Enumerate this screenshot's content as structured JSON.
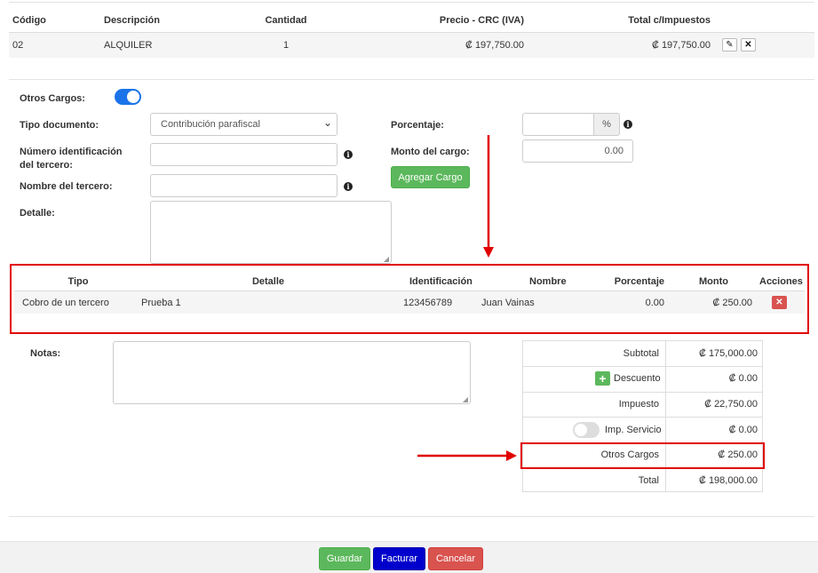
{
  "items_table": {
    "headers": {
      "codigo": "Código",
      "descripcion": "Descripción",
      "cantidad": "Cantidad",
      "precio": "Precio - CRC (IVA)",
      "total": "Total c/Impuestos"
    },
    "rows": [
      {
        "codigo": "02",
        "descripcion": "ALQUILER",
        "cantidad": "1",
        "precio": "₡ 197,750.00",
        "total": "₡ 197,750.00"
      }
    ]
  },
  "otros_cargos": {
    "toggle_label": "Otros Cargos:",
    "toggle_on": true,
    "tipo_documento_label": "Tipo documento:",
    "tipo_documento_value": "Contribución parafiscal",
    "numero_id_label_1": "Número identificación",
    "numero_id_label_2": "del tercero:",
    "nombre_label": "Nombre del tercero:",
    "detalle_label": "Detalle:",
    "porcentaje_label": "Porcentaje:",
    "porcentaje_addon": "%",
    "monto_label": "Monto del cargo:",
    "monto_value": "0.00",
    "agregar_button": "Agregar Cargo"
  },
  "cargos_table": {
    "headers": {
      "tipo": "Tipo",
      "detalle": "Detalle",
      "identificacion": "Identificación",
      "nombre": "Nombre",
      "porcentaje": "Porcentaje",
      "monto": "Monto",
      "acciones": "Acciones"
    },
    "rows": [
      {
        "tipo": "Cobro de un tercero",
        "detalle": "Prueba 1",
        "identificacion": "123456789",
        "nombre": "Juan Vainas",
        "porcentaje": "0.00",
        "monto": "₡ 250.00"
      }
    ]
  },
  "notas": {
    "label": "Notas:"
  },
  "totals": {
    "subtotal_label": "Subtotal",
    "subtotal_value": "₡ 175,000.00",
    "descuento_label": "Descuento",
    "descuento_value": "₡ 0.00",
    "impuesto_label": "Impuesto",
    "impuesto_value": "₡ 22,750.00",
    "imp_servicio_label": "Imp. Servicio",
    "imp_servicio_value": "₡ 0.00",
    "otros_cargos_label": "Otros Cargos",
    "otros_cargos_value": "₡ 250.00",
    "total_label": "Total",
    "total_value": "₡ 198,000.00"
  },
  "footer": {
    "guardar": "Guardar",
    "facturar": "Facturar",
    "cancelar": "Cancelar"
  },
  "colors": {
    "toggle_on": "#1a73e8",
    "success": "#5cb85c",
    "primary": "#0000cc",
    "danger": "#d9534f",
    "annotation": "#e10000"
  }
}
